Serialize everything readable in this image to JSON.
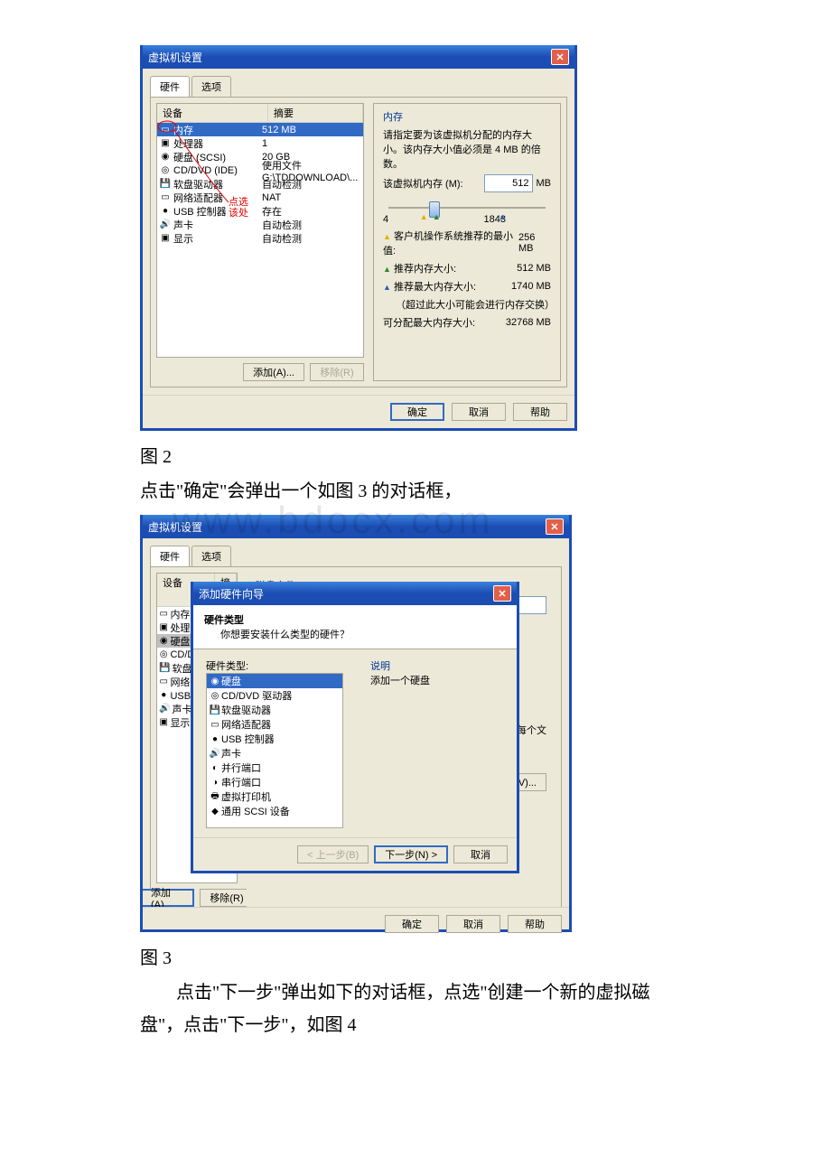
{
  "captions": {
    "fig2": "图 2",
    "fig3": "图 3"
  },
  "paragraphs": {
    "p1": "点击\"确定\"会弹出一个如图 3 的对话框，",
    "p2": "点击\"下一步\"弹出如下的对话框，点选\"创建一个新的虚拟磁盘\"，点击\"下一步\"，如图 4"
  },
  "watermark": "www.bdocx.com",
  "vm_settings": {
    "title": "虚拟机设置",
    "tabs": {
      "hw": "硬件",
      "opt": "选项"
    },
    "columns": {
      "device": "设备",
      "summary": "摘要"
    },
    "devices": [
      {
        "icon": "▭",
        "name": "内存",
        "summary": "512 MB"
      },
      {
        "icon": "▣",
        "name": "处理器",
        "summary": "1"
      },
      {
        "icon": "◉",
        "name": "硬盘 (SCSI)",
        "summary": "20 GB"
      },
      {
        "icon": "◎",
        "name": "CD/DVD (IDE)",
        "summary": "使用文件 G:\\TDDOWNLOAD\\..."
      },
      {
        "icon": "💾",
        "name": "软盘驱动器",
        "summary": "自动检测"
      },
      {
        "icon": "▭",
        "name": "网络适配器",
        "summary": "NAT"
      },
      {
        "icon": "●",
        "name": "USB 控制器",
        "summary": "存在"
      },
      {
        "icon": "🔊",
        "name": "声卡",
        "summary": "自动检测"
      },
      {
        "icon": "▣",
        "name": "显示",
        "summary": "自动检测"
      }
    ],
    "add_btn": "添加(A)...",
    "remove_btn": "移除(R)",
    "memory": {
      "title": "内存",
      "desc": "请指定要为该虚拟机分配的内存大小。该内存大小值必须是 4 MB 的倍数。",
      "label": "该虚拟机内存 (M):",
      "value": "512",
      "unit": "MB",
      "min_tick": "4",
      "max_tick": "1843",
      "guest_min_label": "客户机操作系统推荐的最小值:",
      "guest_min_val": "256 MB",
      "rec_label": "推荐内存大小:",
      "rec_val": "512 MB",
      "rec_max_label": "推荐最大内存大小:",
      "rec_max_val": "1740 MB",
      "swap_note": "（超过此大小可能会进行内存交换）",
      "alloc_max_label": "可分配最大内存大小:",
      "alloc_max_val": "32768 MB"
    },
    "annotation": {
      "line1": "点选",
      "line2": "该处"
    },
    "footer": {
      "ok": "确定",
      "cancel": "取消",
      "help": "帮助"
    }
  },
  "vm_settings2": {
    "title": "虚拟机设置",
    "right_title": "磁盘文件",
    "right_note": "文件，每个文",
    "adv_btn": "高级(V)..."
  },
  "wizard": {
    "title": "添加硬件向导",
    "h1": "硬件类型",
    "h2": "你想要安装什么类型的硬件？",
    "list_label": "硬件类型:",
    "desc_label": "说明",
    "desc_text": "添加一个硬盘",
    "items": [
      {
        "icon": "◉",
        "name": "硬盘"
      },
      {
        "icon": "◎",
        "name": "CD/DVD 驱动器"
      },
      {
        "icon": "💾",
        "name": "软盘驱动器"
      },
      {
        "icon": "▭",
        "name": "网络适配器"
      },
      {
        "icon": "●",
        "name": "USB 控制器"
      },
      {
        "icon": "🔊",
        "name": "声卡"
      },
      {
        "icon": "◐",
        "name": "并行端口"
      },
      {
        "icon": "◑",
        "name": "串行端口"
      },
      {
        "icon": "🖶",
        "name": "虚拟打印机"
      },
      {
        "icon": "◆",
        "name": "通用 SCSI 设备"
      }
    ],
    "back": "< 上一步(B)",
    "next": "下一步(N) >",
    "cancel": "取消"
  }
}
